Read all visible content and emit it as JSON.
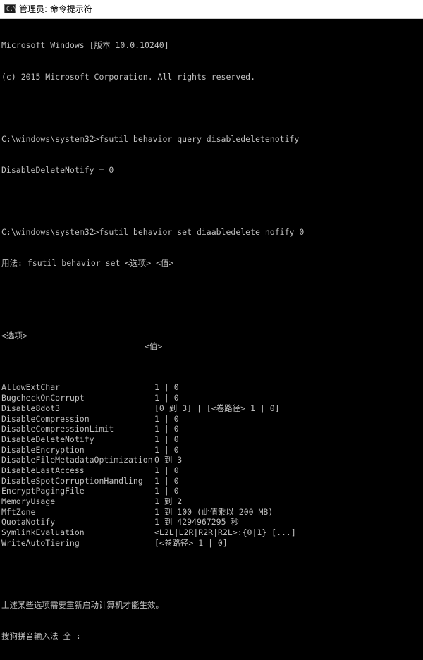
{
  "window": {
    "title": "管理员: 命令提示符",
    "icon": "cmd-icon"
  },
  "console": {
    "header_lines": [
      "Microsoft Windows [版本 10.0.10240]",
      "(c) 2015 Microsoft Corporation. All rights reserved."
    ],
    "command1": "C:\\windows\\system32>fsutil behavior query disabledeletenotify",
    "output1": "DisableDeleteNotify = 0",
    "command2": "C:\\windows\\system32>fsutil behavior set diaabledelete nofify 0",
    "usage": "用法: fsutil behavior set <选项> <值>",
    "table_header": {
      "option": "<选项>",
      "value": "<值>"
    },
    "options": [
      {
        "name": "AllowExtChar",
        "value": "1 | 0"
      },
      {
        "name": "BugcheckOnCorrupt",
        "value": "1 | 0"
      },
      {
        "name": "Disable8dot3",
        "value": "[0 到 3] | [<卷路径> 1 | 0]"
      },
      {
        "name": "DisableCompression",
        "value": "1 | 0"
      },
      {
        "name": "DisableCompressionLimit",
        "value": "1 | 0"
      },
      {
        "name": "DisableDeleteNotify",
        "value": "1 | 0"
      },
      {
        "name": "DisableEncryption",
        "value": "1 | 0"
      },
      {
        "name": "DisableFileMetadataOptimization",
        "value": "0 到 3"
      },
      {
        "name": "DisableLastAccess",
        "value": "1 | 0"
      },
      {
        "name": "DisableSpotCorruptionHandling",
        "value": "1 | 0"
      },
      {
        "name": "EncryptPagingFile",
        "value": "1 | 0"
      },
      {
        "name": "MemoryUsage",
        "value": "1 到 2"
      },
      {
        "name": "MftZone",
        "value": "1 到 100 (此值乘以 200 MB)"
      },
      {
        "name": "QuotaNotify",
        "value": "1 到 4294967295 秒"
      },
      {
        "name": "SymlinkEvaluation",
        "value": "<L2L|L2R|R2R|R2L>:{0|1} [...]"
      },
      {
        "name": "WriteAutoTiering",
        "value": "[<卷路径> 1 | 0]"
      }
    ],
    "footer": "上述某些选项需要重新启动计算机才能生效。",
    "ime_status": "搜狗拼音输入法 全 :"
  }
}
